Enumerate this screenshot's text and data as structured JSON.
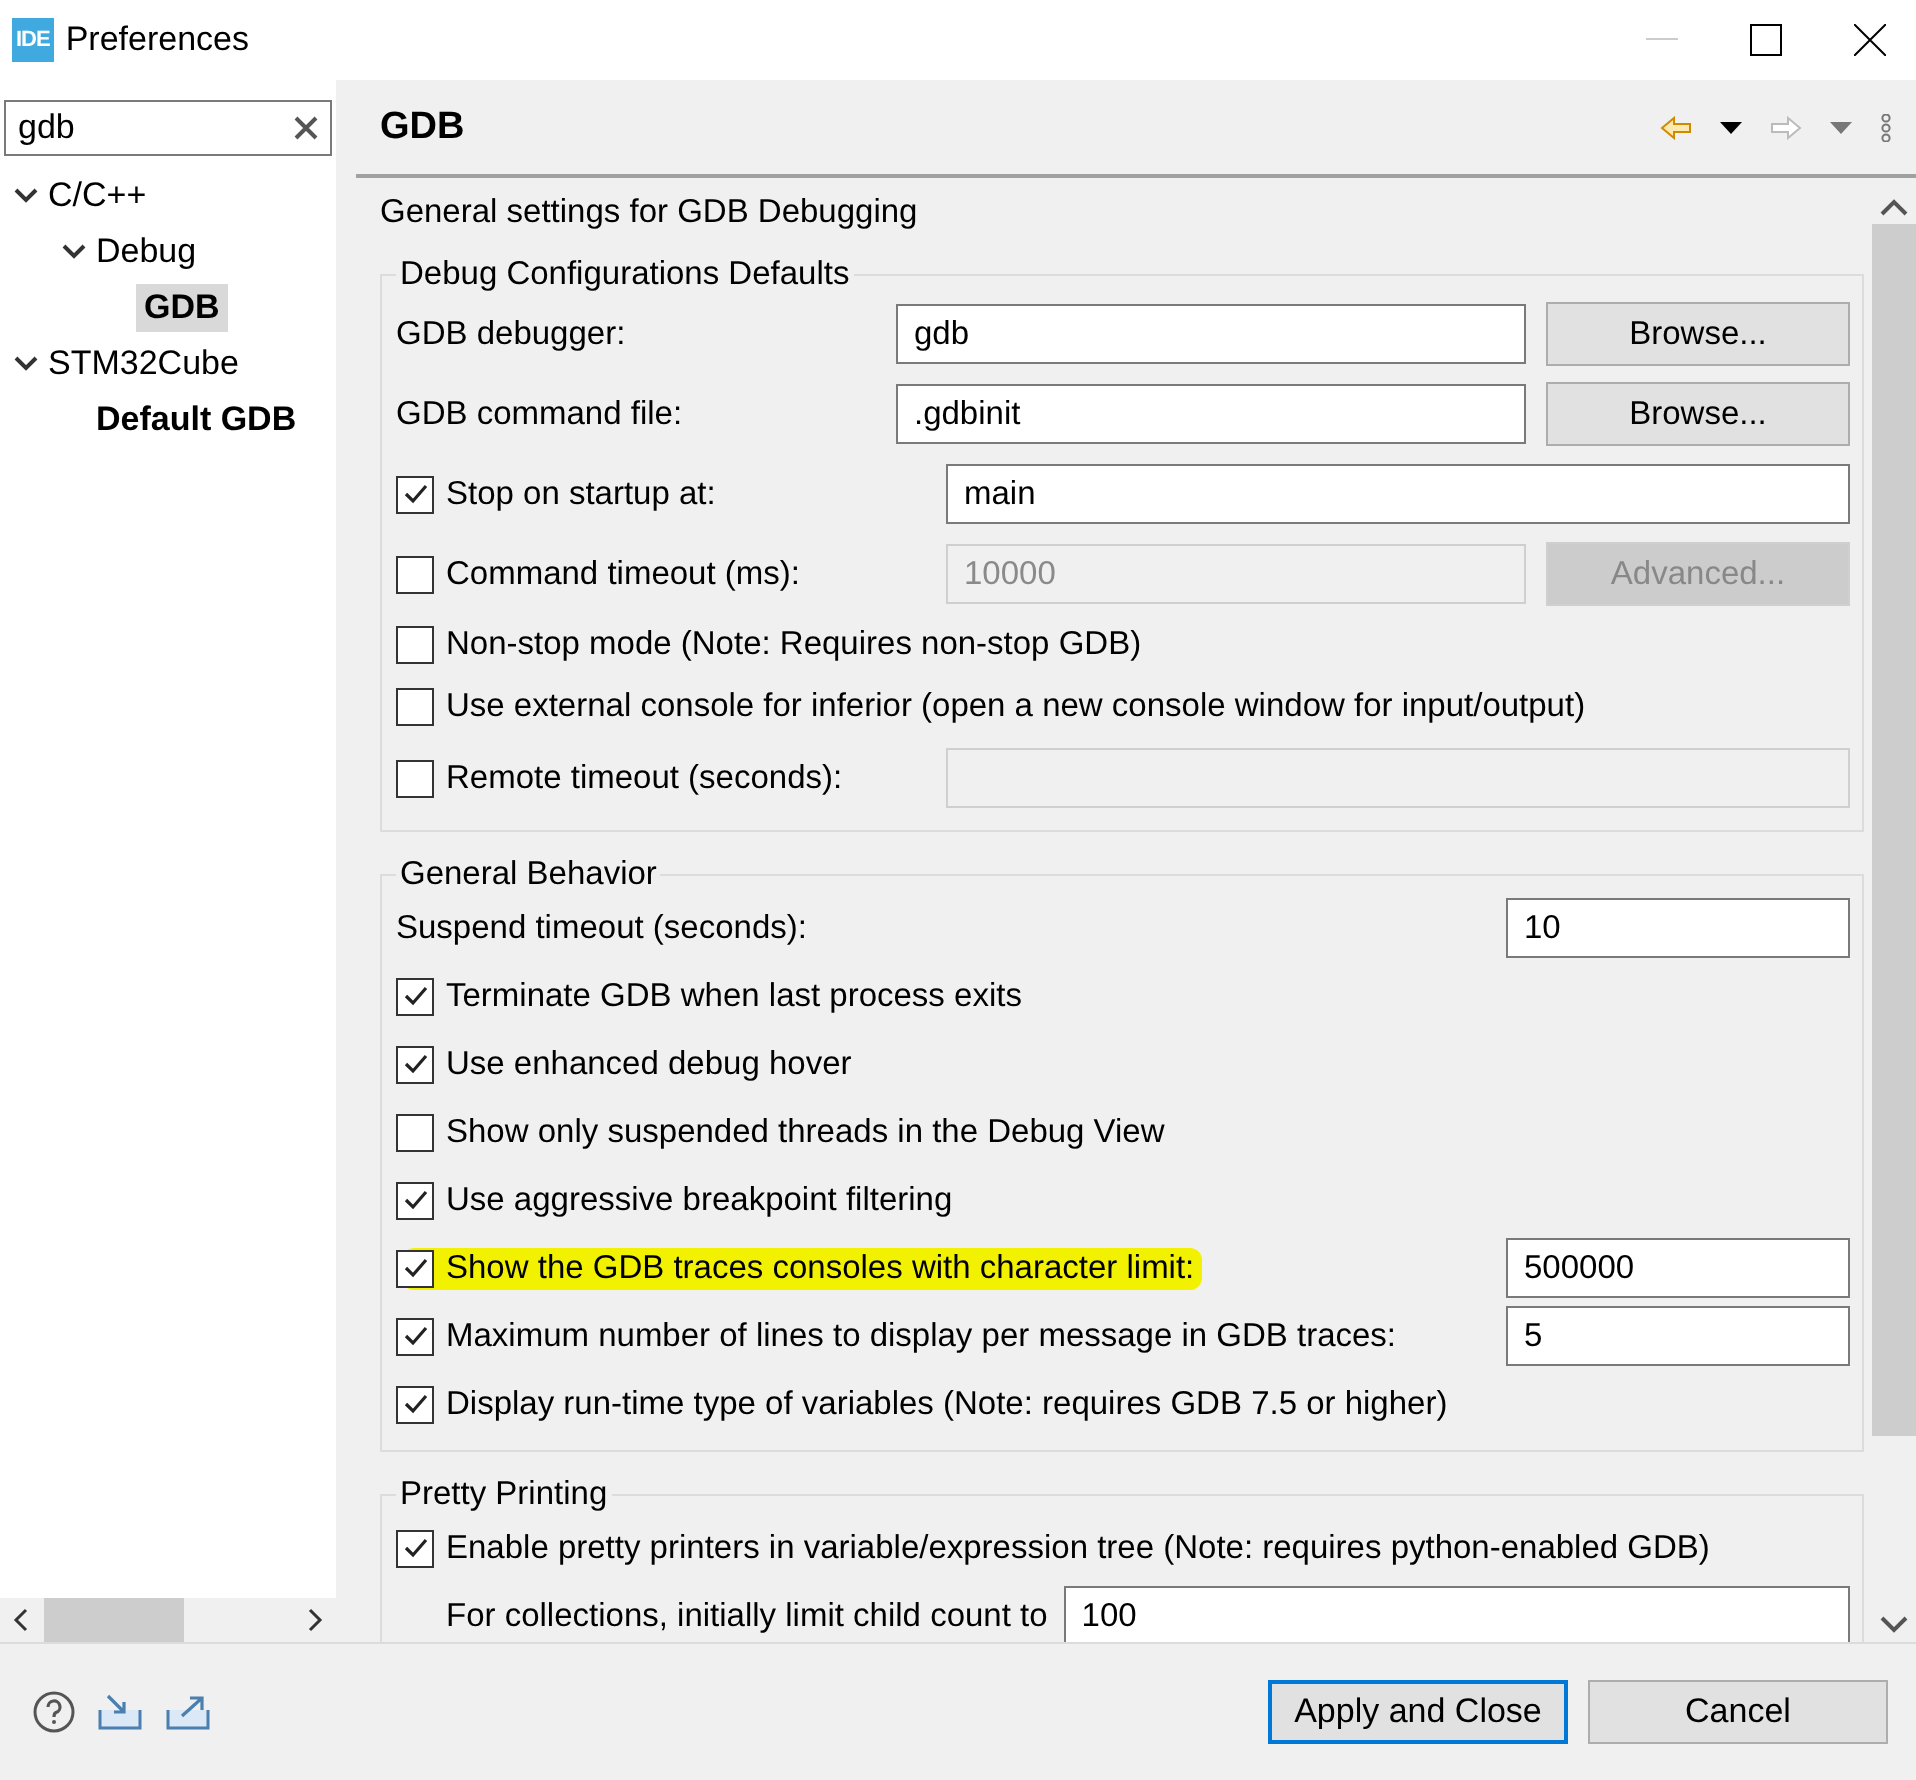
{
  "window": {
    "logo": "IDE",
    "title": "Preferences"
  },
  "sidebar": {
    "search": {
      "value": "gdb"
    },
    "tree": [
      {
        "label": "C/C++",
        "expanded": true,
        "match": false,
        "selected": false,
        "children": [
          {
            "label": "Debug",
            "expanded": true,
            "match": false,
            "selected": false,
            "children": [
              {
                "label": "GDB",
                "match": true,
                "selected": true
              }
            ]
          }
        ]
      },
      {
        "label": "STM32Cube",
        "expanded": true,
        "match": false,
        "selected": false,
        "children": [
          {
            "label": "Default GDB",
            "match": true,
            "selected": false
          }
        ]
      }
    ]
  },
  "page": {
    "title": "GDB",
    "description": "General settings for GDB Debugging"
  },
  "groups": [
    {
      "title": "Debug Configurations Defaults",
      "kind": "columns",
      "rows": [
        {
          "kind": "field",
          "label": "GDB debugger:",
          "field": {
            "value": "gdb",
            "disabled": false
          },
          "button": {
            "label": "Browse...",
            "disabled": false
          }
        },
        {
          "kind": "field",
          "label": "GDB command file:",
          "field": {
            "value": ".gdbinit",
            "disabled": false
          },
          "button": {
            "label": "Browse...",
            "disabled": false
          }
        },
        {
          "kind": "check",
          "label": "Stop on startup at:",
          "checked": true,
          "field": {
            "value": "main",
            "disabled": false
          }
        },
        {
          "kind": "check",
          "label": "Command timeout (ms):",
          "checked": false,
          "field": {
            "value": "10000",
            "disabled": true
          },
          "button": {
            "label": "Advanced...",
            "disabled": true
          }
        },
        {
          "kind": "check",
          "label": "Non-stop mode (Note: Requires non-stop GDB)",
          "checked": false
        },
        {
          "kind": "check",
          "label": "Use external console for inferior (open a new console window for input/output)",
          "checked": false
        },
        {
          "kind": "check",
          "label": "Remote timeout (seconds):",
          "checked": false,
          "field": {
            "disabled": true
          }
        }
      ]
    },
    {
      "title": "General Behavior",
      "kind": "trailing",
      "rows": [
        {
          "kind": "field",
          "label": "Suspend timeout (seconds):",
          "field": {
            "value": "10",
            "disabled": false
          }
        },
        {
          "kind": "check",
          "label": "Terminate GDB when last process exits",
          "checked": true
        },
        {
          "kind": "check",
          "label": "Use enhanced debug hover",
          "checked": true
        },
        {
          "kind": "check",
          "label": "Show only suspended threads in the Debug View",
          "checked": false
        },
        {
          "kind": "check",
          "label": "Use aggressive breakpoint filtering",
          "checked": true
        },
        {
          "kind": "check",
          "label": "Show the GDB traces consoles with character limit:",
          "checked": true,
          "highlighted": true,
          "field": {
            "value": "500000",
            "disabled": false
          }
        },
        {
          "kind": "check",
          "label": "Maximum number of lines to display per message in GDB traces:",
          "checked": true,
          "field": {
            "value": "5",
            "disabled": false
          }
        },
        {
          "kind": "check",
          "label": "Display run-time type of variables (Note: requires GDB 7.5 or higher)",
          "checked": true
        }
      ]
    },
    {
      "title": "Pretty Printing",
      "kind": "inline",
      "rows": [
        {
          "kind": "check",
          "label": "Enable pretty printers in variable/expression tree (Note: requires python-enabled GDB)",
          "checked": true
        },
        {
          "kind": "field",
          "label": "For collections, initially limit child count to",
          "indented": true,
          "field": {
            "value": "100",
            "disabled": false
          }
        }
      ]
    }
  ],
  "buttons": [
    {
      "label": "Apply and Close",
      "default": true
    },
    {
      "label": "Cancel",
      "default": false
    }
  ]
}
